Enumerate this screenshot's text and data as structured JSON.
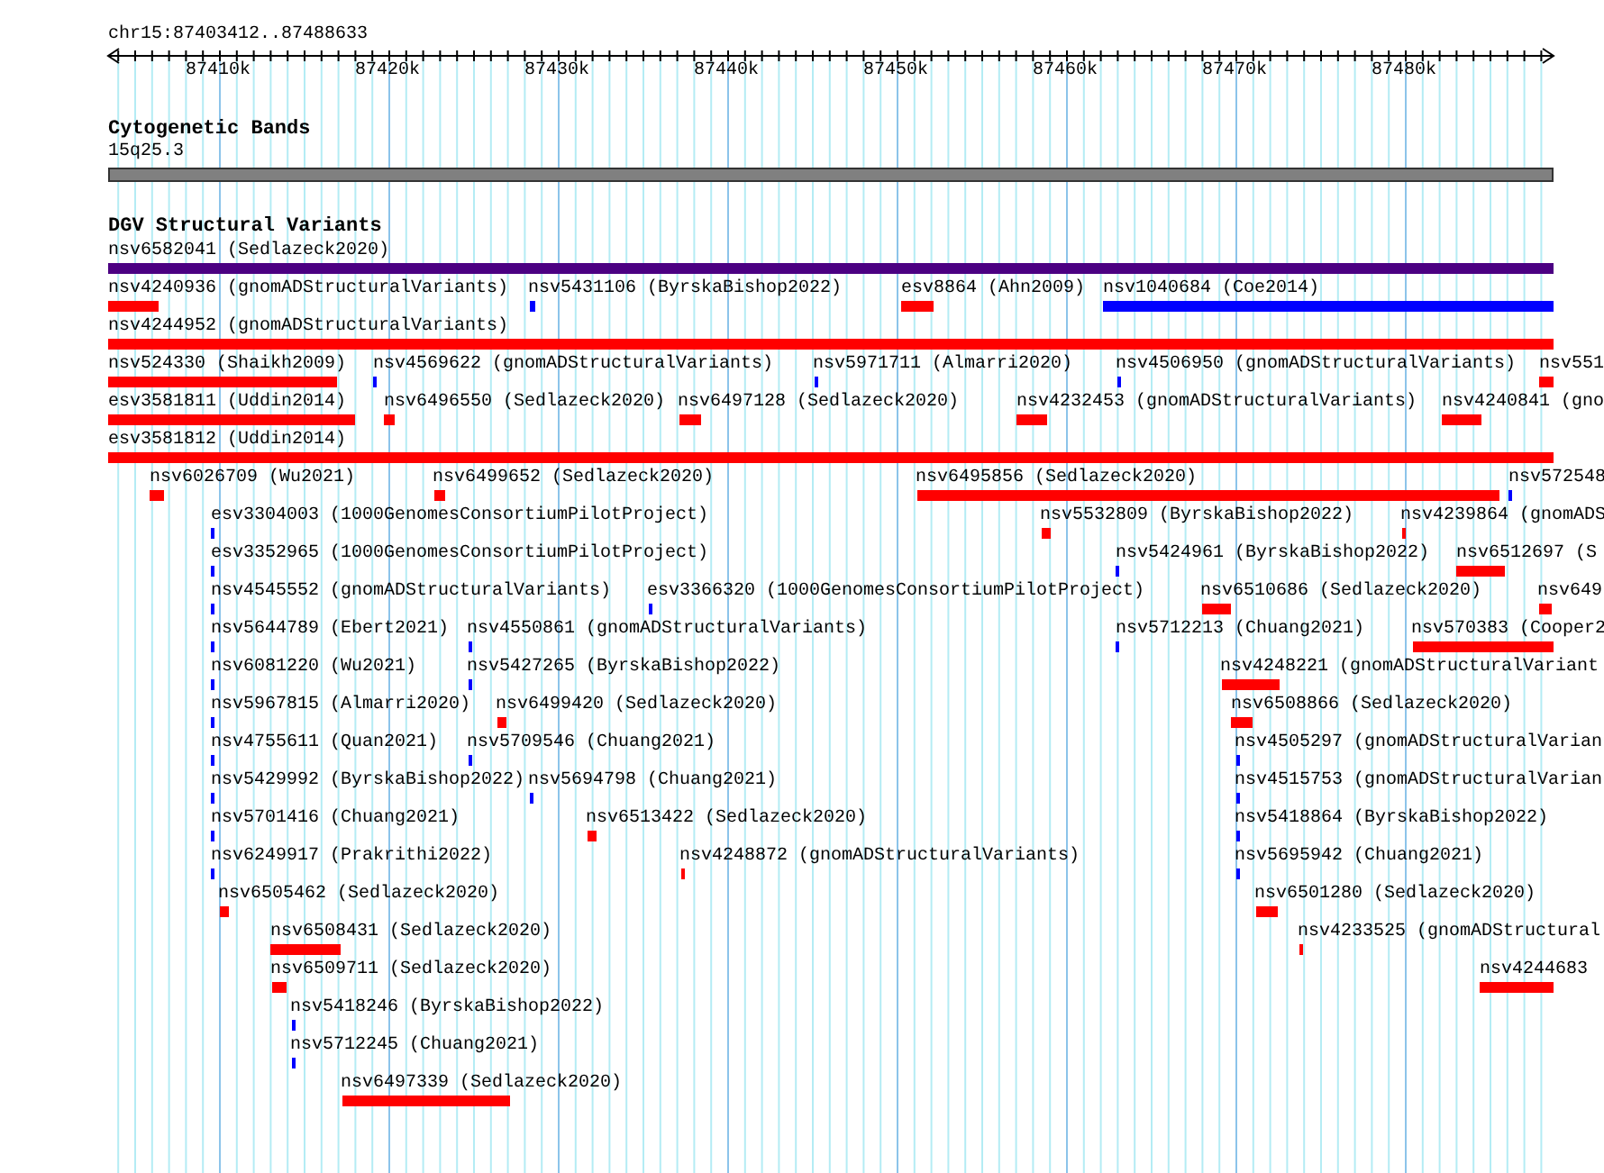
{
  "ruler": {
    "region": "chr15:87403412..87488633",
    "ticks": [
      "87410k",
      "87420k",
      "87430k",
      "87440k",
      "87450k",
      "87460k",
      "87470k",
      "87480k"
    ]
  },
  "tracks": [
    {
      "kind": "bands",
      "title": "Cytogenetic Bands",
      "features": [
        {
          "label": "15q25.3",
          "color": "#808080"
        }
      ]
    },
    {
      "kind": "variants",
      "title": "DGV Structural Variants",
      "features": [
        {
          "label": "nsv6582041 (Sedlazeck2020)",
          "color": "#4b0082"
        },
        {
          "label": "nsv4240936 (gnomADStructuralVariants)",
          "color": "#ff0000"
        },
        {
          "label": "nsv5431106 (ByrskaBishop2022)",
          "color": "#0000ff"
        },
        {
          "label": "esv8864 (Ahn2009)",
          "color": "#ff0000"
        },
        {
          "label": "nsv1040684 (Coe2014)",
          "color": "#0000ff"
        },
        {
          "label": "nsv4244952 (gnomADStructuralVariants)",
          "color": "#ff0000"
        },
        {
          "label": "nsv524330 (Shaikh2009)",
          "color": "#ff0000"
        },
        {
          "label": "nsv4569622 (gnomADStructuralVariants)",
          "color": "#0000ff"
        },
        {
          "label": "nsv5971711 (Almarri2020)",
          "color": "#0000ff"
        },
        {
          "label": "nsv4506950 (gnomADStructuralVariants)",
          "color": "#0000ff"
        },
        {
          "label": "nsv551",
          "color": "#ff0000"
        },
        {
          "label": "esv3581811 (Uddin2014)",
          "color": "#ff0000"
        },
        {
          "label": "nsv6496550 (Sedlazeck2020)",
          "color": "#ff0000"
        },
        {
          "label": "nsv6497128 (Sedlazeck2020)",
          "color": "#ff0000"
        },
        {
          "label": "nsv4232453 (gnomADStructuralVariants)",
          "color": "#ff0000"
        },
        {
          "label": "nsv4240841 (gno",
          "color": "#ff0000"
        },
        {
          "label": "esv3581812 (Uddin2014)",
          "color": "#ff0000"
        },
        {
          "label": "nsv6026709 (Wu2021)",
          "color": "#ff0000"
        },
        {
          "label": "nsv6499652 (Sedlazeck2020)",
          "color": "#ff0000"
        },
        {
          "label": "nsv6495856 (Sedlazeck2020)",
          "color": "#ff0000"
        },
        {
          "label": "nsv572548",
          "color": "#0000ff"
        },
        {
          "label": "esv3304003 (1000GenomesConsortiumPilotProject)",
          "color": "#0000ff"
        },
        {
          "label": "nsv5532809 (ByrskaBishop2022)",
          "color": "#ff0000"
        },
        {
          "label": "nsv4239864 (gnomADS",
          "color": "#ff0000"
        },
        {
          "label": "esv3352965 (1000GenomesConsortiumPilotProject)",
          "color": "#0000ff"
        },
        {
          "label": "nsv5424961 (ByrskaBishop2022)",
          "color": "#0000ff"
        },
        {
          "label": "nsv6512697 (S",
          "color": "#ff0000"
        },
        {
          "label": "nsv4545552 (gnomADStructuralVariants)",
          "color": "#0000ff"
        },
        {
          "label": "esv3366320 (1000GenomesConsortiumPilotProject)",
          "color": "#0000ff"
        },
        {
          "label": "nsv6510686 (Sedlazeck2020)",
          "color": "#ff0000"
        },
        {
          "label": "nsv649",
          "color": "#ff0000"
        },
        {
          "label": "nsv5644789 (Ebert2021)",
          "color": "#0000ff"
        },
        {
          "label": "nsv4550861 (gnomADStructuralVariants)",
          "color": "#0000ff"
        },
        {
          "label": "nsv5712213 (Chuang2021)",
          "color": "#0000ff"
        },
        {
          "label": "nsv570383 (Cooper2",
          "color": "#ff0000"
        },
        {
          "label": "nsv6081220 (Wu2021)",
          "color": "#0000ff"
        },
        {
          "label": "nsv5427265 (ByrskaBishop2022)",
          "color": "#0000ff"
        },
        {
          "label": "nsv4248221 (gnomADStructuralVariant",
          "color": "#ff0000"
        },
        {
          "label": "nsv5967815 (Almarri2020)",
          "color": "#0000ff"
        },
        {
          "label": "nsv6499420 (Sedlazeck2020)",
          "color": "#ff0000"
        },
        {
          "label": "nsv6508866 (Sedlazeck2020)",
          "color": "#ff0000"
        },
        {
          "label": "nsv4755611 (Quan2021)",
          "color": "#0000ff"
        },
        {
          "label": "nsv5709546 (Chuang2021)",
          "color": "#0000ff"
        },
        {
          "label": "nsv4505297 (gnomADStructuralVarian",
          "color": "#0000ff"
        },
        {
          "label": "nsv5429992 (ByrskaBishop2022)",
          "color": "#0000ff"
        },
        {
          "label": "nsv5694798 (Chuang2021)",
          "color": "#0000ff"
        },
        {
          "label": "nsv4515753 (gnomADStructuralVarian",
          "color": "#0000ff"
        },
        {
          "label": "nsv5701416 (Chuang2021)",
          "color": "#0000ff"
        },
        {
          "label": "nsv6513422 (Sedlazeck2020)",
          "color": "#ff0000"
        },
        {
          "label": "nsv5418864 (ByrskaBishop2022)",
          "color": "#0000ff"
        },
        {
          "label": "nsv6249917 (Prakrithi2022)",
          "color": "#0000ff"
        },
        {
          "label": "nsv4248872 (gnomADStructuralVariants)",
          "color": "#ff0000"
        },
        {
          "label": "nsv5695942 (Chuang2021)",
          "color": "#0000ff"
        },
        {
          "label": "nsv6505462 (Sedlazeck2020)",
          "color": "#ff0000"
        },
        {
          "label": "nsv6501280 (Sedlazeck2020)",
          "color": "#ff0000"
        },
        {
          "label": "nsv6508431 (Sedlazeck2020)",
          "color": "#ff0000"
        },
        {
          "label": "nsv4233525 (gnomADStructural",
          "color": "#ff0000"
        },
        {
          "label": "nsv6509711 (Sedlazeck2020)",
          "color": "#ff0000"
        },
        {
          "label": "nsv4244683",
          "color": "#ff0000"
        },
        {
          "label": "nsv5418246 (ByrskaBishop2022)",
          "color": "#0000ff"
        },
        {
          "label": "nsv5712245 (Chuang2021)",
          "color": "#0000ff"
        },
        {
          "label": "nsv6497339 (Sedlazeck2020)",
          "color": "#ff0000"
        }
      ]
    }
  ]
}
